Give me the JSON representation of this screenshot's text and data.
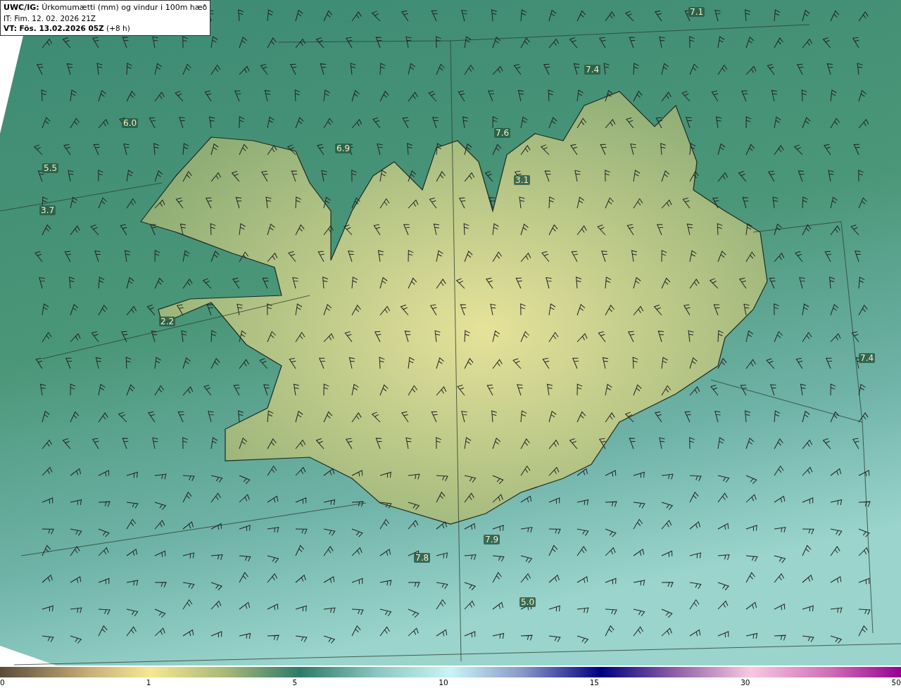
{
  "title_box": {
    "heading": "**UWC/IG:** Úrkomumætti (mm) og vindur i 100m hæð",
    "issue_time": "IT: Fim. 12. 02. 2026 21Z",
    "valid_time": "**VT: Fös. 13.02.2026 05Z** (+8 h)"
  },
  "map_labels": [
    "7.1",
    "7.4",
    "6.0",
    "7.6",
    "6.9",
    "5.5",
    "3.1",
    "3.7",
    "2.2",
    "7.4",
    "7.9",
    "7.8",
    "5.0"
  ],
  "colorbar": {
    "ticks": [
      "0",
      "1",
      "5",
      "10",
      "15",
      "30",
      "50"
    ]
  }
}
